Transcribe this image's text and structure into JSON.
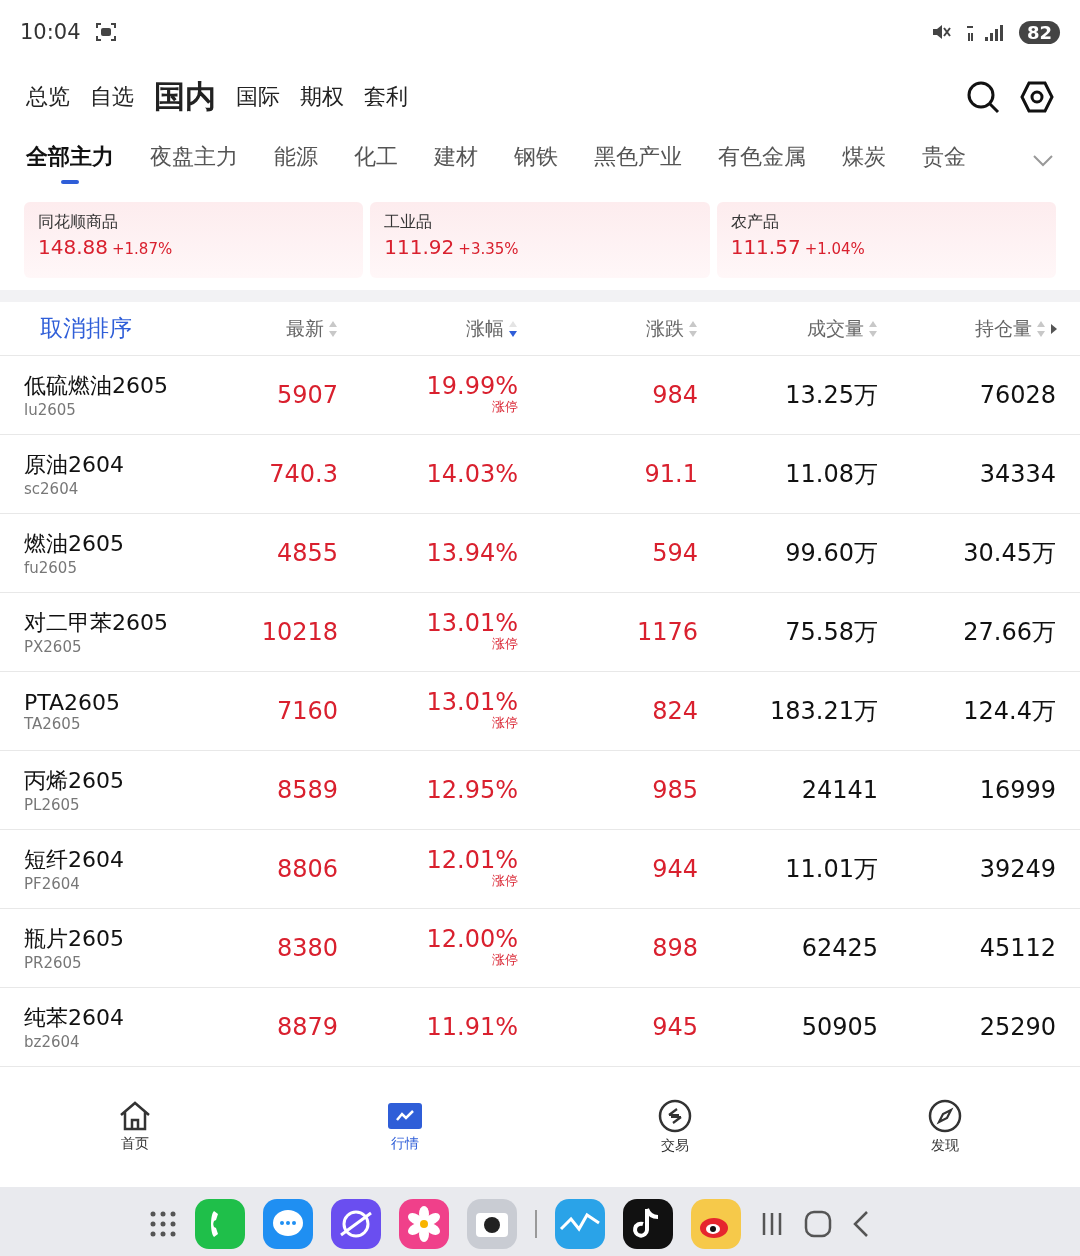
{
  "status_bar": {
    "time": "10:04",
    "battery": "82"
  },
  "top_tabs": [
    {
      "label": "总览",
      "selected": false
    },
    {
      "label": "自选",
      "selected": false
    },
    {
      "label": "国内",
      "selected": true
    },
    {
      "label": "国际",
      "selected": false
    },
    {
      "label": "期权",
      "selected": false
    },
    {
      "label": "套利",
      "selected": false
    }
  ],
  "category_tabs": [
    {
      "label": "全部主力",
      "selected": true
    },
    {
      "label": "夜盘主力",
      "selected": false
    },
    {
      "label": "能源",
      "selected": false
    },
    {
      "label": "化工",
      "selected": false
    },
    {
      "label": "建材",
      "selected": false
    },
    {
      "label": "钢铁",
      "selected": false
    },
    {
      "label": "黑色产业",
      "selected": false
    },
    {
      "label": "有色金属",
      "selected": false
    },
    {
      "label": "煤炭",
      "selected": false
    },
    {
      "label": "贵金",
      "selected": false
    }
  ],
  "index_cards": [
    {
      "name": "同花顺商品",
      "value": "148.88",
      "change": "+1.87%"
    },
    {
      "name": "工业品",
      "value": "111.92",
      "change": "+3.35%"
    },
    {
      "name": "农产品",
      "value": "111.57",
      "change": "+1.04%"
    }
  ],
  "table": {
    "cancel_sort": "取消排序",
    "columns": [
      {
        "label": "最新",
        "sorted": false
      },
      {
        "label": "涨幅",
        "sorted": true
      },
      {
        "label": "涨跌",
        "sorted": false
      },
      {
        "label": "成交量",
        "sorted": false
      },
      {
        "label": "持仓量",
        "sorted": false
      }
    ],
    "rows": [
      {
        "name": "低硫燃油2605",
        "code": "lu2605",
        "price": "5907",
        "change_pct": "19.99%",
        "limit_tag": "涨停",
        "change": "984",
        "volume": "13.25万",
        "open_interest": "76028"
      },
      {
        "name": "原油2604",
        "code": "sc2604",
        "price": "740.3",
        "change_pct": "14.03%",
        "change": "91.1",
        "volume": "11.08万",
        "open_interest": "34334"
      },
      {
        "name": "燃油2605",
        "code": "fu2605",
        "price": "4855",
        "change_pct": "13.94%",
        "change": "594",
        "volume": "99.60万",
        "open_interest": "30.45万"
      },
      {
        "name": "对二甲苯2605",
        "code": "PX2605",
        "price": "10218",
        "change_pct": "13.01%",
        "limit_tag": "涨停",
        "change": "1176",
        "volume": "75.58万",
        "open_interest": "27.66万"
      },
      {
        "name": "PTA2605",
        "code": "TA2605",
        "price": "7160",
        "change_pct": "13.01%",
        "limit_tag": "涨停",
        "change": "824",
        "volume": "183.21万",
        "open_interest": "124.4万"
      },
      {
        "name": "丙烯2605",
        "code": "PL2605",
        "price": "8589",
        "change_pct": "12.95%",
        "change": "985",
        "volume": "24141",
        "open_interest": "16999"
      },
      {
        "name": "短纤2604",
        "code": "PF2604",
        "price": "8806",
        "change_pct": "12.01%",
        "limit_tag": "涨停",
        "change": "944",
        "volume": "11.01万",
        "open_interest": "39249"
      },
      {
        "name": "瓶片2605",
        "code": "PR2605",
        "price": "8380",
        "change_pct": "12.00%",
        "limit_tag": "涨停",
        "change": "898",
        "volume": "62425",
        "open_interest": "45112"
      },
      {
        "name": "纯苯2604",
        "code": "bz2604",
        "price": "8879",
        "change_pct": "11.91%",
        "change": "945",
        "volume": "50905",
        "open_interest": "25290"
      }
    ]
  },
  "bottom_nav": [
    {
      "label": "首页",
      "kind": "home",
      "selected": false
    },
    {
      "label": "行情",
      "kind": "market",
      "selected": true
    },
    {
      "label": "交易",
      "kind": "trade",
      "selected": false
    },
    {
      "label": "发现",
      "kind": "discover",
      "selected": false
    }
  ],
  "dock": [
    {
      "kind": "apps"
    },
    {
      "kind": "phone"
    },
    {
      "kind": "messages"
    },
    {
      "kind": "browser"
    },
    {
      "kind": "gallery"
    },
    {
      "kind": "camera"
    },
    {
      "kind": "divider"
    },
    {
      "kind": "stocks"
    },
    {
      "kind": "music"
    },
    {
      "kind": "social"
    },
    {
      "kind": "recents"
    },
    {
      "kind": "home"
    },
    {
      "kind": "back"
    }
  ]
}
